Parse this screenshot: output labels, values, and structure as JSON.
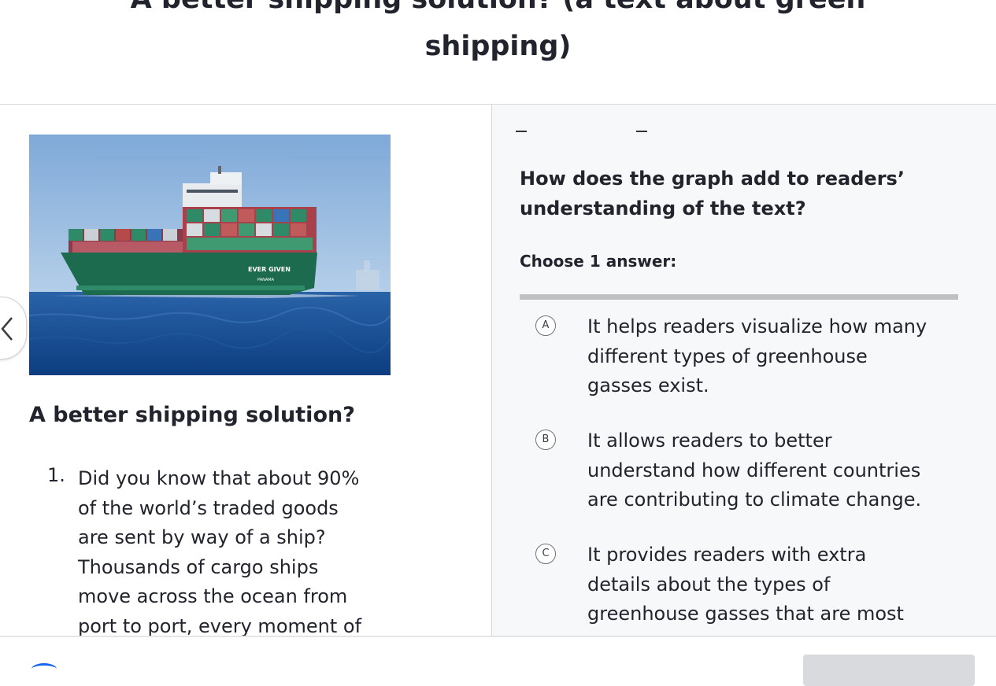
{
  "title": {
    "line1": "A better shipping solution? (a text about green",
    "line2": "shipping)"
  },
  "article": {
    "heading": "A better shipping solution?",
    "paragraph_number": "1.",
    "paragraph_lines": [
      "Did you know that about 90%",
      "of the world’s traded goods",
      "are sent by way of a ship?",
      "Thousands of cargo ships",
      "move across the ocean from",
      "port to port, every moment of"
    ],
    "image": {
      "ship_name": "EVER GIVEN",
      "port": "PANAMA"
    }
  },
  "question": {
    "lines": [
      "How does the graph add to readers’",
      "understanding of the text?"
    ],
    "choose_label": "Choose 1 answer:",
    "choices": [
      {
        "letter": "A",
        "lines": [
          "It helps readers visualize how many",
          "different types of greenhouse",
          "gasses exist."
        ]
      },
      {
        "letter": "B",
        "lines": [
          "It allows readers to better",
          "understand how different countries",
          "are contributing to climate change."
        ]
      },
      {
        "letter": "C",
        "lines": [
          "It provides readers with extra",
          "details about the types of",
          "greenhouse gasses that are most"
        ]
      }
    ]
  },
  "colors": {
    "text": "#21242c",
    "pane_background": "#f7f8fa",
    "hull_green": "#1d6b4f",
    "sea_blue": "#124b94",
    "sky_blue": "#8fb6de",
    "accent": "#1865f2"
  },
  "icons": {
    "prev": "chevron-left-icon"
  }
}
